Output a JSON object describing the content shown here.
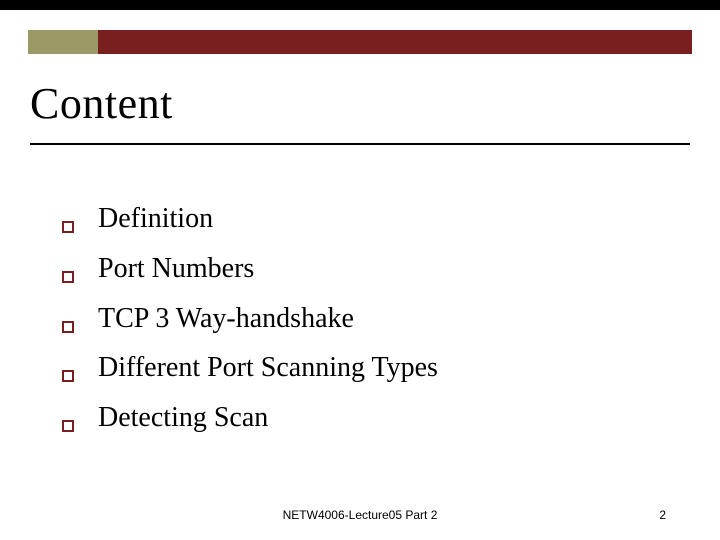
{
  "title": "Content",
  "bullets": [
    "Definition",
    "Port Numbers",
    "TCP 3 Way-handshake",
    "Different Port Scanning Types",
    "Detecting Scan"
  ],
  "footer": {
    "center": "NETW4006-Lecture05 Part 2",
    "pageNumber": "2"
  },
  "colors": {
    "accentLeft": "#9a9a66",
    "accentRight": "#7a1f1f"
  }
}
